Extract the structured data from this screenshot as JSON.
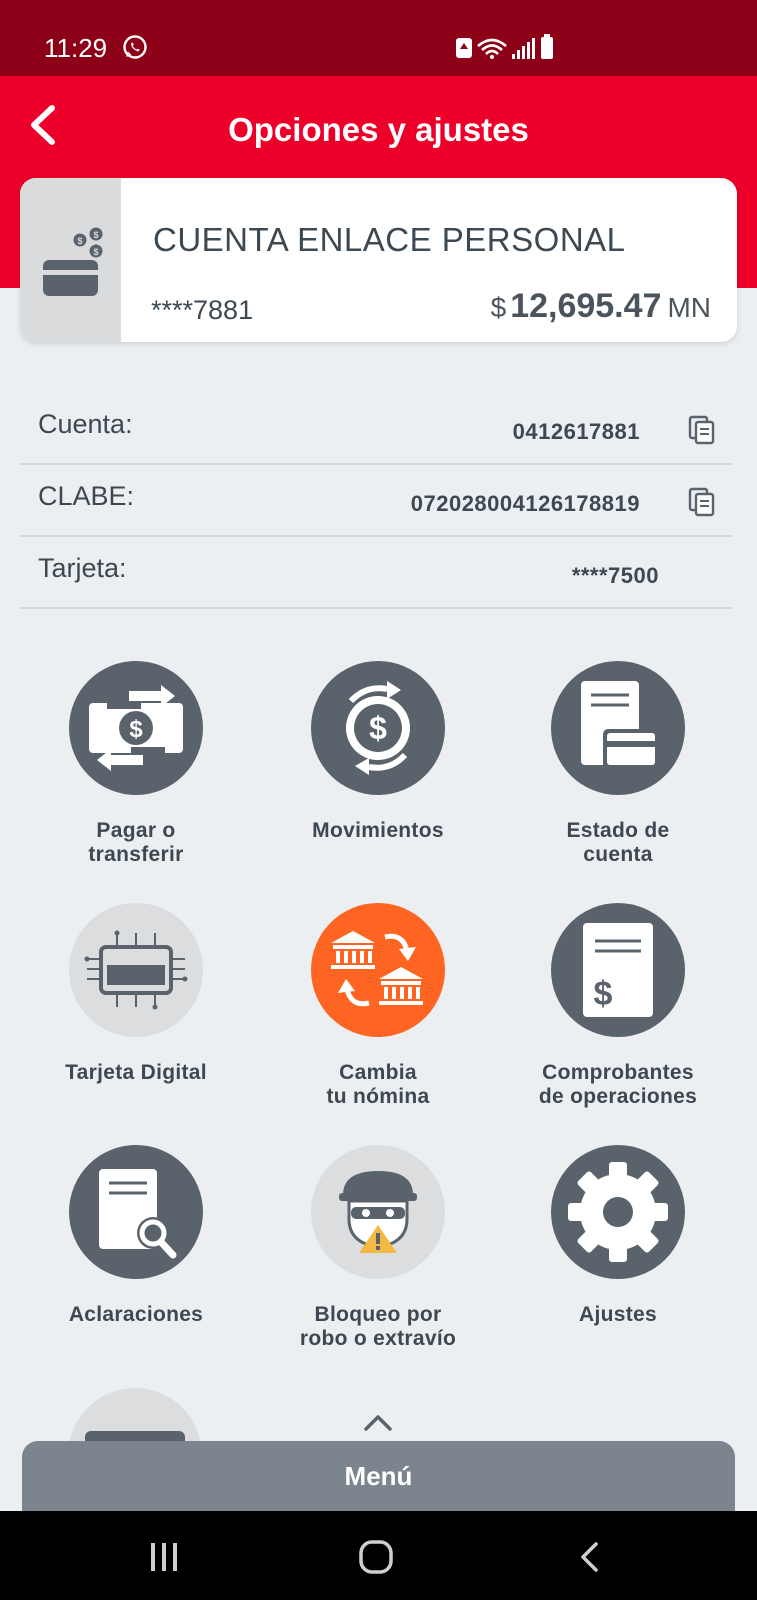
{
  "status_bar": {
    "time": "11:29"
  },
  "header": {
    "title": "Opciones y ajustes"
  },
  "account": {
    "name": "CUENTA ENLACE PERSONAL",
    "masked_number": "****7881",
    "currency_symbol": "$",
    "balance": "12,695.47",
    "currency_unit": "MN"
  },
  "details": [
    {
      "label": "Cuenta:",
      "value": "0412617881"
    },
    {
      "label": "CLABE:",
      "value": "072028004126178819"
    },
    {
      "label": "Tarjeta:",
      "value": "****7500"
    }
  ],
  "options": [
    {
      "label": "Pagar o\ntransferir",
      "icon": "pay-transfer-icon"
    },
    {
      "label": "Movimientos",
      "icon": "movements-icon"
    },
    {
      "label": "Estado de\ncuenta",
      "icon": "statement-icon"
    },
    {
      "label": "Tarjeta Digital",
      "icon": "digital-card-icon"
    },
    {
      "label": "Cambia\ntu nómina",
      "icon": "payroll-change-icon"
    },
    {
      "label": "Comprobantes\nde operaciones",
      "icon": "receipt-icon"
    },
    {
      "label": "Aclaraciones",
      "icon": "clarification-icon"
    },
    {
      "label": "Bloqueo por\nrobo o extravío",
      "icon": "thief-block-icon"
    },
    {
      "label": "Ajustes",
      "icon": "gear-icon"
    }
  ],
  "menu": {
    "label": "Menú"
  },
  "colors": {
    "brand_red": "#ec0029",
    "dark_red": "#8d0118",
    "icon_gray": "#5a636c",
    "accent_orange": "#fe6522"
  }
}
